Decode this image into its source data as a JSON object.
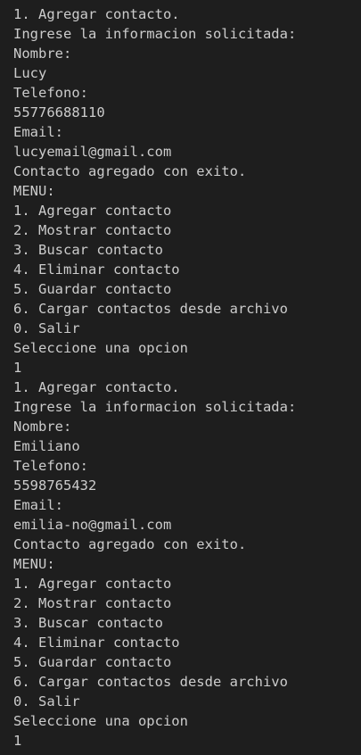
{
  "terminal": {
    "lines": [
      "1. Agregar contacto.",
      "Ingrese la informacion solicitada:",
      "Nombre:",
      "Lucy",
      "Telefono:",
      "55776688110",
      "Email:",
      "lucyemail@gmail.com",
      "Contacto agregado con exito.",
      "MENU:",
      "1. Agregar contacto",
      "2. Mostrar contacto",
      "3. Buscar contacto",
      "4. Eliminar contacto",
      "5. Guardar contacto",
      "6. Cargar contactos desde archivo",
      "0. Salir",
      "Seleccione una opcion",
      "1",
      "1. Agregar contacto.",
      "Ingrese la informacion solicitada:",
      "Nombre:",
      "Emiliano",
      "Telefono:",
      "5598765432",
      "Email:",
      "emilia-no@gmail.com",
      "Contacto agregado con exito.",
      "MENU:",
      "1. Agregar contacto",
      "2. Mostrar contacto",
      "3. Buscar contacto",
      "4. Eliminar contacto",
      "5. Guardar contacto",
      "6. Cargar contactos desde archivo",
      "0. Salir",
      "Seleccione una opcion",
      "1"
    ],
    "colors": {
      "background": "#1e1e1e",
      "text": "#cccccc"
    }
  }
}
